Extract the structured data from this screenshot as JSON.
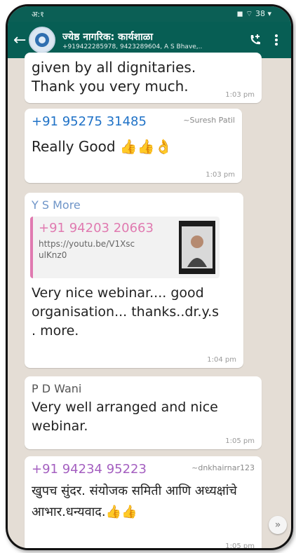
{
  "status_bar": {
    "time": "अ:१",
    "right_icons": "◼ ⌔ 38 ▾"
  },
  "header": {
    "title": "ज्येष्ठ नागरिक: कार्यशाळा",
    "subtitle": "+919422285978, 9423289604, A S Bhave,..",
    "back_icon": "arrow-left-icon",
    "call_icon": "phone-plus-icon",
    "menu_icon": "more-vert-icon"
  },
  "messages": [
    {
      "type": "text",
      "text": "given by all dignitaries. Thank you very much.",
      "time": "1:03 pm"
    },
    {
      "type": "text",
      "sender": "+91 95275 31485",
      "sender_color": "#1f72c7",
      "alias": "~Suresh Patil",
      "text": "Really Good 👍👍👌",
      "time": "1:03 pm"
    },
    {
      "type": "link",
      "sender": "Y S More",
      "sender_color": "#6f95c8",
      "quote": {
        "sender": "+91 94203 20663",
        "sender_color": "#e07ab0",
        "url": "https://youtu.be/V1XsculKnz0"
      },
      "text": "Very nice webinar.... good organisation... thanks..dr.y.s . more.",
      "time": "1:04 pm"
    },
    {
      "type": "text",
      "sender": "P D Wani",
      "sender_color": "#555555",
      "text": "Very well arranged and nice webinar.",
      "time": "1:05 pm"
    },
    {
      "type": "text",
      "sender": "+91 94234 95223",
      "sender_color": "#a45fc0",
      "alias": "~dnkhairnar123",
      "text": "खुपच सुंदर. संयोजक समिती आणि अध्यक्षांचे आभार.धन्यवाद.👍👍",
      "time": "1:05 pm"
    }
  ],
  "colors": {
    "header_bg": "#075e54",
    "chat_bg": "#e4ddd5"
  },
  "scroll_icon": "double-chevron-down-icon"
}
